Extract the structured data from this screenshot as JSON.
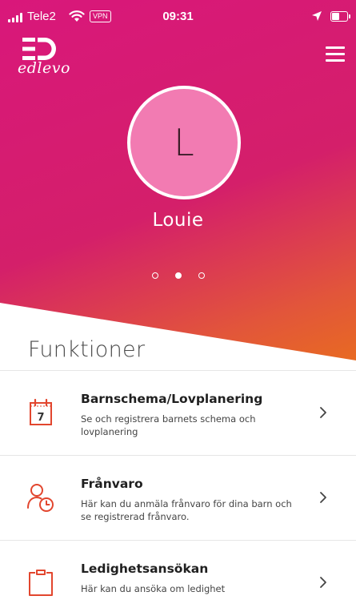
{
  "status_bar": {
    "carrier": "Tele2",
    "vpn": "VPN",
    "time": "09:31"
  },
  "app": {
    "logo_text": "edlevo"
  },
  "profile": {
    "initial": "L",
    "name": "Louie",
    "avatar_color": "#f27bb2",
    "page_count": 3,
    "active_page": 2
  },
  "colors": {
    "gradient_start": "#d9177b",
    "gradient_end": "#e86a22",
    "icon_accent": "#e2462e"
  },
  "functions": {
    "title": "Funktioner",
    "items": [
      {
        "icon": "calendar-icon",
        "icon_number": "7",
        "title": "Barnschema/Lovplanering",
        "description": "Se och registrera barnets schema och lovplanering"
      },
      {
        "icon": "person-clock-icon",
        "title": "Frånvaro",
        "description": "Här kan du anmäla frånvaro för dina barn och se registrerad frånvaro."
      },
      {
        "icon": "clipboard-icon",
        "title": "Ledighetsansökan",
        "description": "Här kan du ansöka om ledighet"
      }
    ]
  }
}
